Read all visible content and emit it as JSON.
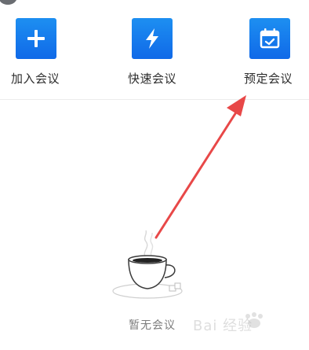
{
  "actions": [
    {
      "id": "join",
      "label": "加入会议",
      "icon": "plus-icon"
    },
    {
      "id": "quick",
      "label": "快速会议",
      "icon": "lightning-icon"
    },
    {
      "id": "schedule",
      "label": "预定会议",
      "icon": "calendar-check-icon"
    }
  ],
  "empty_state": {
    "text": "暂无会议",
    "icon": "coffee-cup-icon"
  },
  "annotation": {
    "icon": "red-arrow-icon",
    "color": "#e84848"
  },
  "watermark": {
    "text": "Bai 经验",
    "icon": "baidu-paw-logo"
  },
  "colors": {
    "accent": "#1677f0",
    "text": "#2d2d2d",
    "muted": "#7d7d7d",
    "divider": "#ececec"
  }
}
